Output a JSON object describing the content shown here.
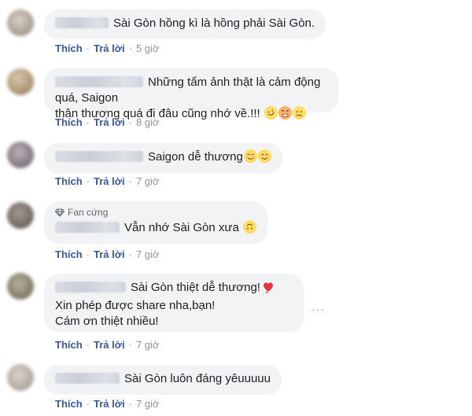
{
  "actions": {
    "like": "Thích",
    "reply": "Trả lời",
    "separator": "·"
  },
  "more_icon": "more-options-icon",
  "comments": [
    {
      "text": "Sài Gòn hồng kì là hồng phải Sài Gòn.",
      "time": "5 giờ",
      "emojis": []
    },
    {
      "text_line1": "Những tấm ảnh thật là cảm động quá, Saigon",
      "text_line2": "thân thương quá đi đâu cũng nhớ về.!!! ",
      "time": "8 giờ",
      "emojis": [
        "rofl-face-icon",
        "angry-face-icon",
        "crying-face-icon"
      ]
    },
    {
      "text": "Saigon dễ thương",
      "time": "7 giờ",
      "emojis": [
        "smiling-face-icon",
        "smiling-face-icon"
      ]
    },
    {
      "badge": "Fan cứng",
      "text": "Vẫn nhớ Sài Gòn xưa ",
      "time": "7 giờ",
      "emojis": [
        "upside-down-face-icon"
      ]
    },
    {
      "text_line1": "Sài Gòn thiệt dễ thương!",
      "text_line2": "Xin phép được share nha,bạn!",
      "text_line3": "Cám ơn thiệt nhiều!",
      "time": "7 giờ",
      "emojis": [
        "heart-exclamation-icon"
      ]
    },
    {
      "text": "Sài Gòn luôn đáng yêuuuuu",
      "time": "7 giờ",
      "emojis": []
    }
  ]
}
